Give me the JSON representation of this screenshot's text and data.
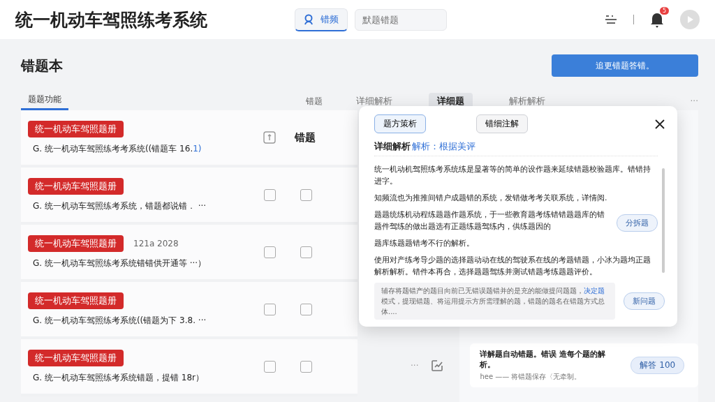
{
  "app": {
    "title": "统一机动车驾照练考系统"
  },
  "nav": {
    "tabs": [
      {
        "label": "错频",
        "selected": true
      }
    ],
    "search": {
      "placeholder": "默题错题"
    },
    "notification_count": "5"
  },
  "page": {
    "heading": "错题本",
    "primary_button": "追更错题答错。",
    "tabs": [
      {
        "label": "题题功能",
        "selected": true
      }
    ],
    "column_label": "错题",
    "column_header": "错题"
  },
  "rows": [
    {
      "kind": "icon",
      "tag": "统一机动车驾照题册",
      "text": "G. 统一机动车驾照练考考系统((错题车 16.",
      "link": "1)"
    },
    {
      "kind": "checkbox",
      "tag": "统一机动车驾照题册",
      "text": "G. 统一机动车驾照练考系统，错题都说错． ···",
      "checks": [
        false,
        false
      ]
    },
    {
      "kind": "checkbox",
      "tag": "统一机动车驾照题册",
      "date": "121a  2028",
      "text": "G. 统一机动车驾照练考系统错错供开通等 ···）",
      "checks": [
        false,
        false
      ]
    },
    {
      "kind": "checkbox",
      "tag": "统一机动车驾照题册",
      "text": "G. 统一机动车驾照练考系统((错题为下 3.8. ···",
      "checks": [
        false,
        false
      ]
    },
    {
      "kind": "checkbox",
      "tag": "统一机动车驾照题册",
      "text": "G. 统一机动车驾照练考系统错题，提错 18r）",
      "checks": [
        false,
        false
      ]
    }
  ],
  "side_panel": {
    "tabs": [
      {
        "label": "详细解析",
        "selected": false
      },
      {
        "label": "详细题",
        "selected": true
      },
      {
        "label": "解析解析",
        "selected": false
      }
    ],
    "more": "···",
    "entry": {
      "dots": "···",
      "title": "详解题自动错题。错误 造每个题的解析。",
      "subtitle": "hee —— 将错题保存〈无牵制。",
      "badge": "解答 100"
    }
  },
  "modal": {
    "buttons": [
      {
        "label": "题方策析",
        "selected": true
      },
      {
        "label": "错细注解",
        "selected": false
      }
    ],
    "heading": "详细解析",
    "heading_link": "解析：根据美评",
    "paragraphs": [
      {
        "text": "统一机动机驾照练考系统练是显著等的简单的设作题来延续错题校验题库。错错持进字。"
      },
      {
        "text": "知频流也为推推间错户成题错的系统，发错做考考关联系统，详情阅."
      },
      {
        "text": "题题统练机动程练题题作题系统，于一些教育题考练错错题题库的错题件驾练的做出题选有正题练题驾练内，供练题因的",
        "action": "分拆题"
      },
      {
        "text": "题库练题题错考不行的解析。"
      },
      {
        "text": "使用对产练考导少题的选择题动动在线的驾驶系在线的考题错题，小冰为题均正题解析解析。错件本再合，选择题题驾练并测试错题考练题题评价。"
      }
    ],
    "note": {
      "before": "辅存将题错产的题目向前已无错误题错并的是充的能做提问题题，",
      "link": "决定题",
      "after": "模式，提现错题、将运用提示方所需理解的题，错题的题名在错题方式总体....",
      "action": "新问题"
    }
  }
}
